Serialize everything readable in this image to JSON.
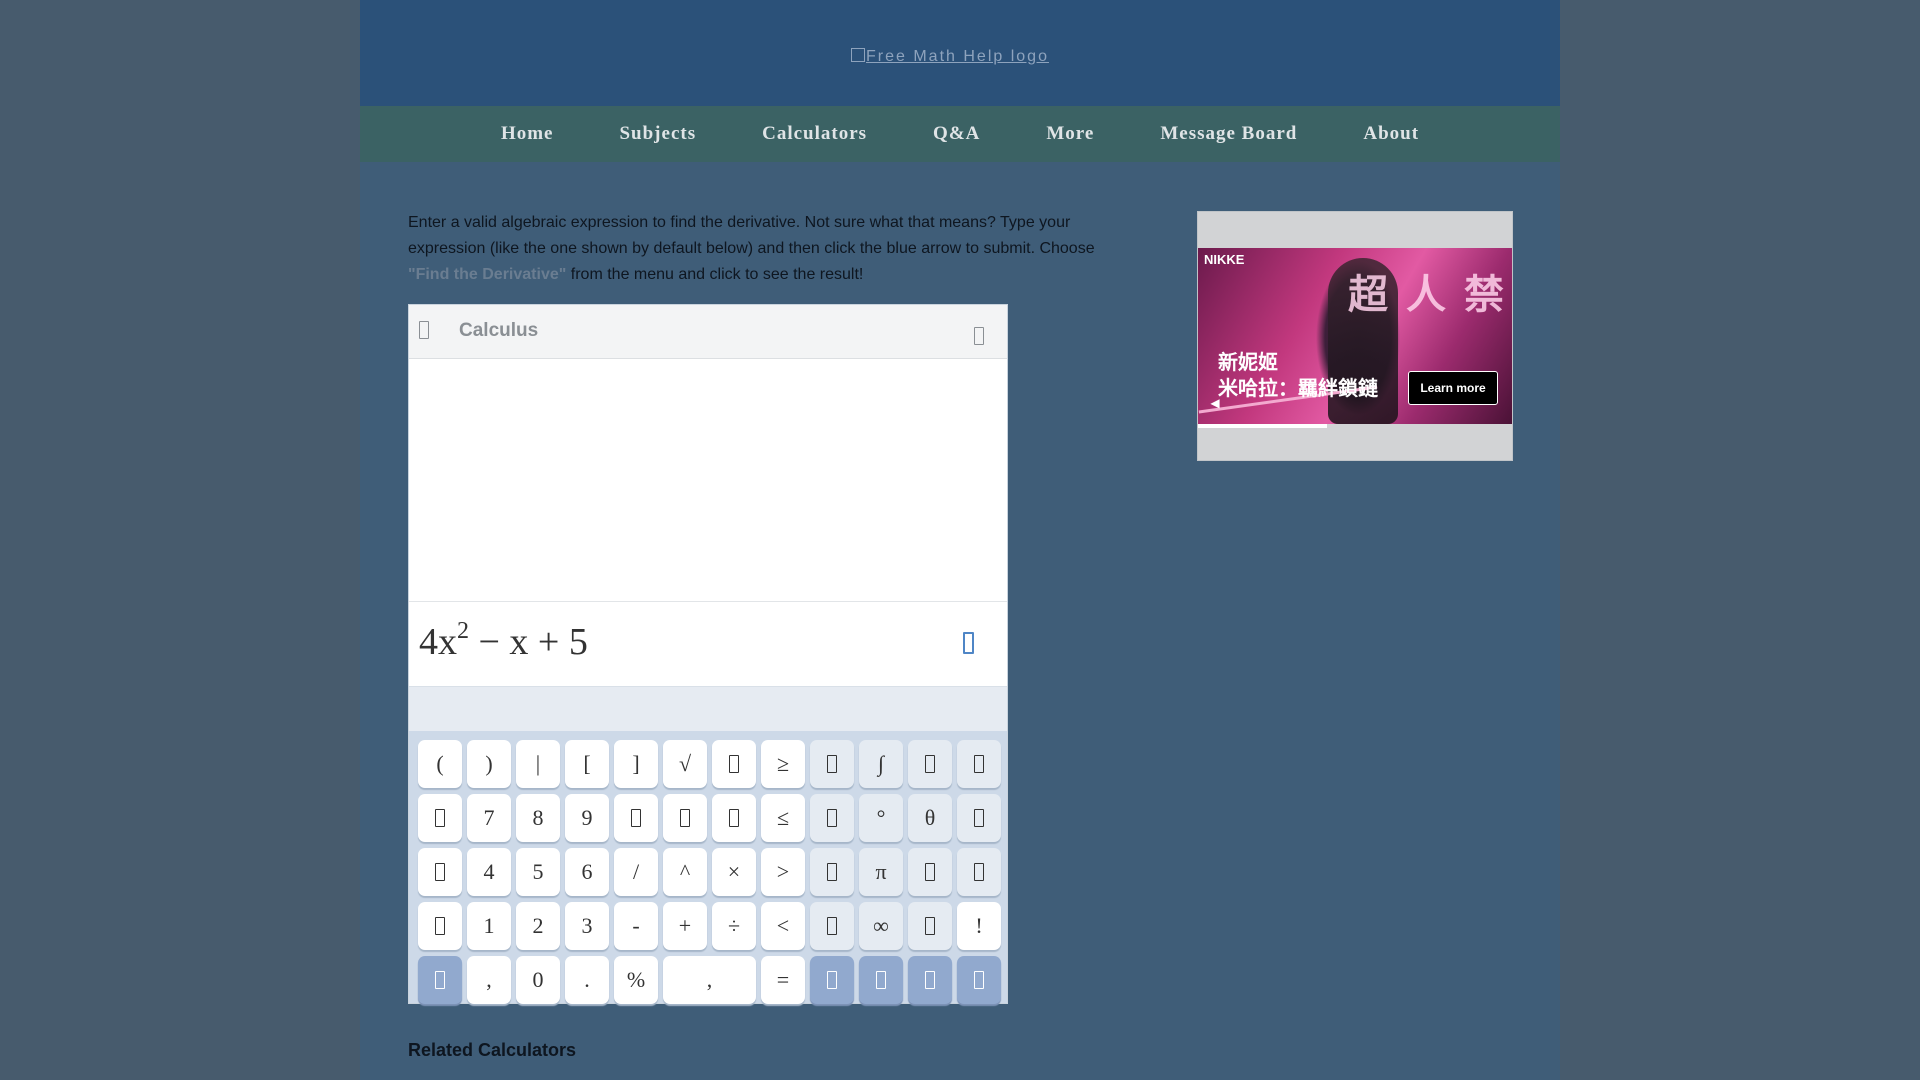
{
  "header": {
    "logo_alt": "Free Math Help logo"
  },
  "nav": {
    "items": [
      "Home",
      "Subjects",
      "Calculators",
      "Q&A",
      "More",
      "Message Board",
      "About"
    ]
  },
  "intro": {
    "text_before": "Enter a valid algebraic expression to find the derivative. Not sure what that means? Type your expression (like the one shown by default below) and then click the blue arrow to submit. Choose ",
    "link": "\"Find the Derivative\"",
    "text_after": " from the menu and click to see the result!"
  },
  "widget": {
    "title": "Calculus",
    "menu_icon": "menu-icon",
    "settings_icon": "settings-icon",
    "submit_icon": "submit-arrow-icon",
    "expression": {
      "coef": "4x",
      "exp": "2",
      "rest": " − x + 5"
    }
  },
  "keypad": {
    "rows": [
      [
        {
          "label": "(",
          "kind": "key"
        },
        {
          "label": ")",
          "kind": "key"
        },
        {
          "label": "|",
          "kind": "key"
        },
        {
          "label": "[",
          "kind": "key"
        },
        {
          "label": "]",
          "kind": "key"
        },
        {
          "label": "√",
          "kind": "key"
        },
        {
          "label": "",
          "kind": "key",
          "icon": "nth-root-icon"
        },
        {
          "label": "≥",
          "kind": "key"
        },
        {
          "label": "",
          "kind": "alt",
          "icon": "log-icon"
        },
        {
          "label": "∫",
          "kind": "alt"
        },
        {
          "label": "",
          "kind": "alt",
          "icon": "definite-integral-icon"
        },
        {
          "label": "",
          "kind": "alt",
          "icon": "derivative-icon"
        }
      ],
      [
        {
          "label": "",
          "kind": "key",
          "icon": "variable-x-icon"
        },
        {
          "label": "7",
          "kind": "key"
        },
        {
          "label": "8",
          "kind": "key"
        },
        {
          "label": "9",
          "kind": "key"
        },
        {
          "label": "",
          "kind": "key",
          "icon": "fraction-icon"
        },
        {
          "label": "",
          "kind": "key",
          "icon": "power-icon"
        },
        {
          "label": "",
          "kind": "key",
          "icon": "subscript-icon"
        },
        {
          "label": "≤",
          "kind": "key"
        },
        {
          "label": "",
          "kind": "alt",
          "icon": "ln-icon"
        },
        {
          "label": "°",
          "kind": "alt"
        },
        {
          "label": "θ",
          "kind": "alt"
        },
        {
          "label": "",
          "kind": "alt",
          "icon": "limit-icon"
        }
      ],
      [
        {
          "label": "",
          "kind": "key",
          "icon": "variable-y-icon"
        },
        {
          "label": "4",
          "kind": "key"
        },
        {
          "label": "5",
          "kind": "key"
        },
        {
          "label": "6",
          "kind": "key"
        },
        {
          "label": "/",
          "kind": "key"
        },
        {
          "label": "^",
          "kind": "key"
        },
        {
          "label": "×",
          "kind": "key"
        },
        {
          "label": ">",
          "kind": "key"
        },
        {
          "label": "",
          "kind": "alt",
          "icon": "exponential-icon"
        },
        {
          "label": "π",
          "kind": "alt"
        },
        {
          "label": "",
          "kind": "alt",
          "icon": "sum-icon"
        },
        {
          "label": "",
          "kind": "alt",
          "icon": "matrix-icon"
        }
      ],
      [
        {
          "label": "",
          "kind": "key",
          "icon": "variable-z-icon"
        },
        {
          "label": "1",
          "kind": "key"
        },
        {
          "label": "2",
          "kind": "key"
        },
        {
          "label": "3",
          "kind": "key"
        },
        {
          "label": "-",
          "kind": "key"
        },
        {
          "label": "+",
          "kind": "key"
        },
        {
          "label": "÷",
          "kind": "key"
        },
        {
          "label": "<",
          "kind": "key"
        },
        {
          "label": "",
          "kind": "alt",
          "icon": "trig-icon"
        },
        {
          "label": "∞",
          "kind": "alt"
        },
        {
          "label": "",
          "kind": "alt",
          "icon": "imaginary-icon"
        },
        {
          "label": "!",
          "kind": "key"
        }
      ],
      [
        {
          "label": "",
          "kind": "blue",
          "icon": "abc-keyboard-icon"
        },
        {
          "label": ",",
          "kind": "key"
        },
        {
          "label": "0",
          "kind": "key"
        },
        {
          "label": ".",
          "kind": "key"
        },
        {
          "label": "%",
          "kind": "key"
        },
        {
          "label": ",",
          "kind": "key",
          "wide": true
        },
        {
          "label": "=",
          "kind": "key"
        },
        {
          "label": "",
          "kind": "blue",
          "icon": "cursor-left-icon"
        },
        {
          "label": "",
          "kind": "blue",
          "icon": "cursor-right-icon"
        },
        {
          "label": "",
          "kind": "blue",
          "icon": "backspace-icon"
        },
        {
          "label": "",
          "kind": "blue",
          "icon": "enter-icon"
        }
      ]
    ]
  },
  "related": {
    "heading": "Related Calculators"
  },
  "ad": {
    "brand": "NIKKE",
    "headline": "超人禁準",
    "line1": "新妮姬",
    "line2": "米哈拉：羈絆鎖鏈",
    "cta": "Learn more",
    "mute_icon": "mute-icon",
    "progress": 0.41
  }
}
